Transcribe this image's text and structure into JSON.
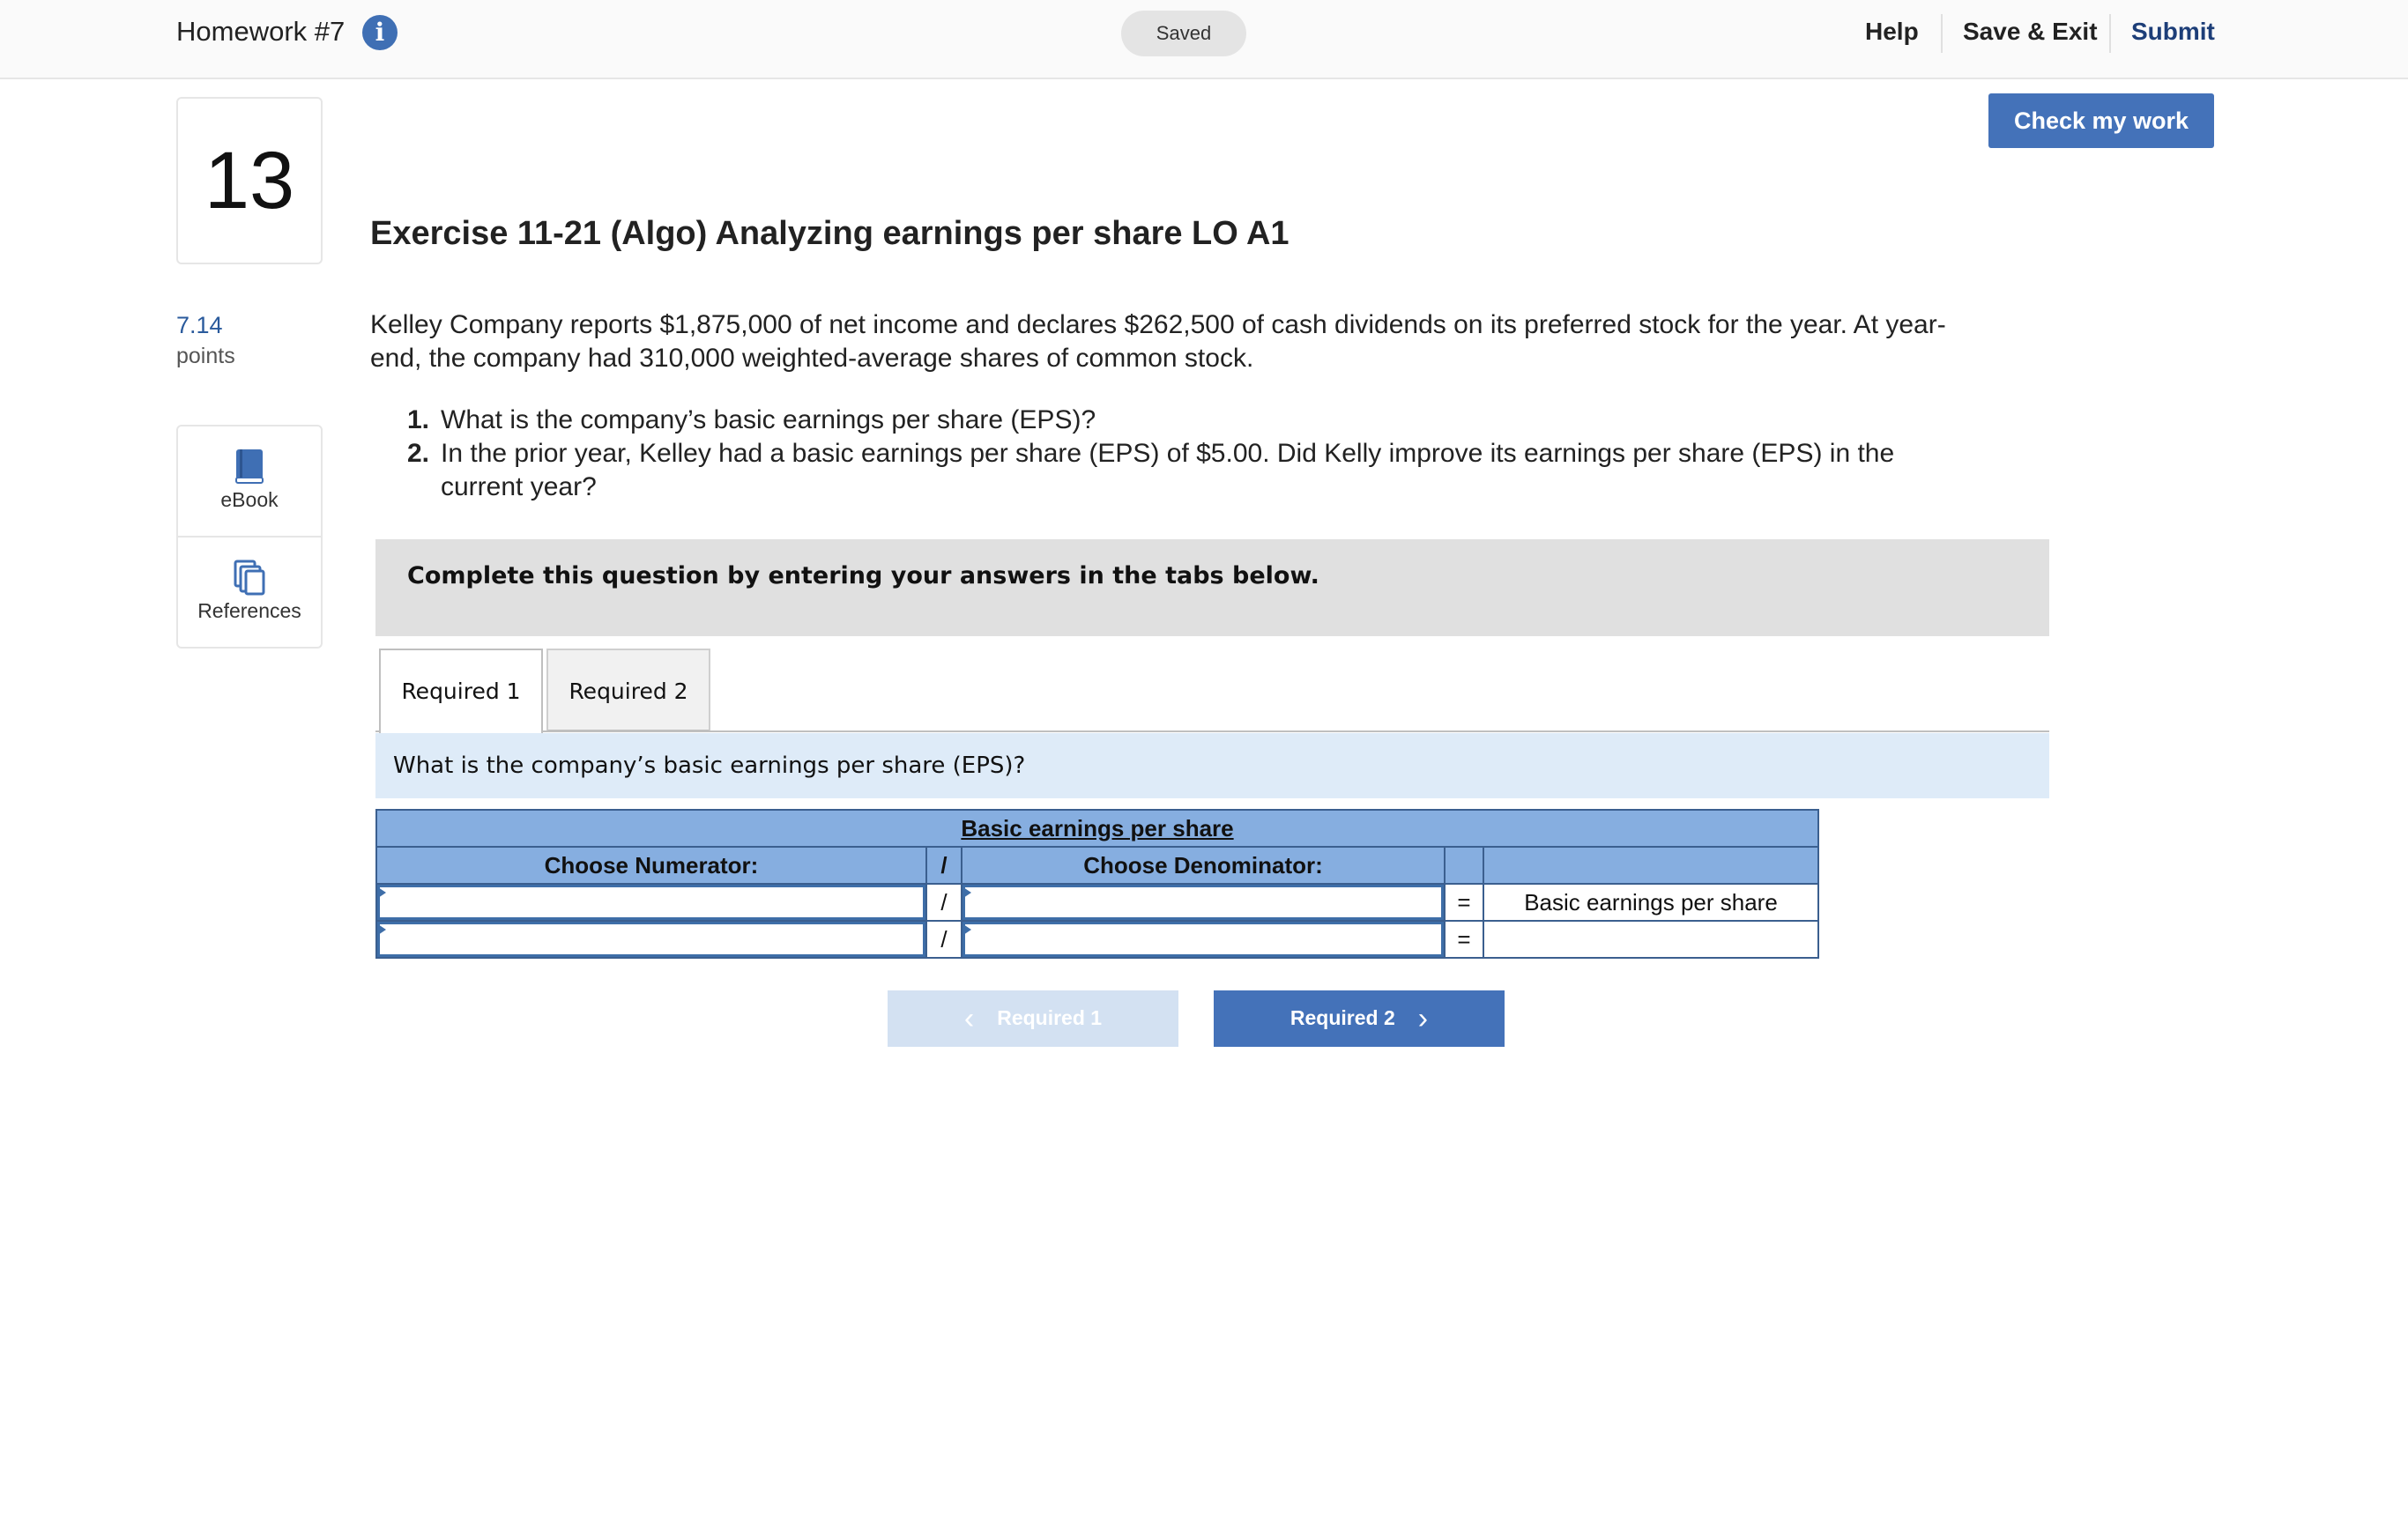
{
  "header": {
    "assignment_title": "Homework #7",
    "info_icon": "i",
    "save_status": "Saved",
    "help_label": "Help",
    "save_exit_label": "Save & Exit",
    "submit_label": "Submit"
  },
  "sidebar": {
    "question_number": "13",
    "points_value": "7.14",
    "points_label": "points",
    "tools": [
      {
        "label": "eBook",
        "icon": "book-icon"
      },
      {
        "label": "References",
        "icon": "copy-icon"
      }
    ]
  },
  "check_my_work_label": "Check my work",
  "exercise": {
    "title": "Exercise 11-21 (Algo) Analyzing earnings per share LO A1",
    "problem_text": "Kelley Company reports $1,875,000 of net income and declares $262,500 of cash dividends on its preferred stock for the year. At year-end, the company had 310,000 weighted-average shares of common stock.",
    "questions": [
      {
        "number": "1.",
        "text": "What is the company’s basic earnings per share (EPS)?"
      },
      {
        "number": "2.",
        "text": "In the prior year, Kelley had a basic earnings per share (EPS) of $5.00. Did Kelly improve its earnings per share (EPS) in the current year?"
      }
    ]
  },
  "instructions": "Complete this question by entering your answers in the tabs below.",
  "tabs": [
    {
      "label": "Required 1",
      "active": true
    },
    {
      "label": "Required 2",
      "active": false
    }
  ],
  "required_question": "What is the company’s basic earnings per share (EPS)?",
  "eps_table": {
    "caption": "Basic earnings per share",
    "numerator_header": "Choose Numerator:",
    "divide_header": "/",
    "denominator_header": "Choose Denominator:",
    "divide_symbol": "/",
    "equals_symbol": "=",
    "rows": [
      {
        "numerator": "",
        "denominator": "",
        "result": "Basic earnings per share"
      },
      {
        "numerator": "",
        "denominator": "",
        "result": ""
      }
    ]
  },
  "navigation": {
    "prev_label": "Required 1",
    "next_label": "Required 2",
    "prev_enabled": false
  },
  "colors": {
    "accent": "#4472b9",
    "table_header": "#86aee0",
    "question_band": "#deebf8",
    "instruction_band": "#e0e0e0",
    "submit_link": "#1d3e78"
  }
}
